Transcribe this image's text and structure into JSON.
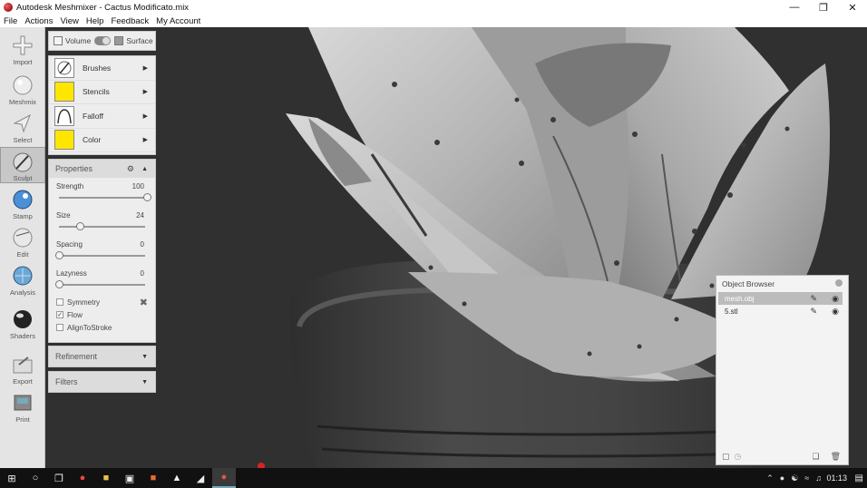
{
  "window": {
    "title": "Autodesk Meshmixer - Cactus Modificato.mix"
  },
  "menu": [
    "File",
    "Actions",
    "View",
    "Help",
    "Feedback",
    "My Account"
  ],
  "tools": [
    {
      "label": "Import",
      "icon": "plus-icon"
    },
    {
      "label": "Meshmix",
      "icon": "sphere-icon"
    },
    {
      "label": "Select",
      "icon": "arrow-cursor-icon"
    },
    {
      "label": "Sculpt",
      "icon": "brush-icon",
      "active": true
    },
    {
      "label": "Stamp",
      "icon": "stamp-icon"
    },
    {
      "label": "Edit",
      "icon": "edit-sphere-icon"
    },
    {
      "label": "Analysis",
      "icon": "analysis-icon"
    },
    {
      "label": "Shaders",
      "icon": "shader-ball-icon"
    },
    {
      "label": "Export",
      "icon": "export-folder-icon"
    },
    {
      "label": "Print",
      "icon": "printer-icon"
    }
  ],
  "sculpt": {
    "mode_volume": "Volume",
    "mode_surface": "Surface",
    "rows": [
      {
        "label": "Brushes",
        "color": "#ffffff",
        "icon": "brush-stroke-icon"
      },
      {
        "label": "Stencils",
        "color": "#ffe600",
        "icon": "stencil-swatch-icon"
      },
      {
        "label": "Falloff",
        "color": "#ffffff",
        "icon": "falloff-curve-icon"
      },
      {
        "label": "Color",
        "color": "#ffe600",
        "icon": "color-swatch-icon"
      }
    ]
  },
  "properties": {
    "title": "Properties",
    "sliders": [
      {
        "name": "Strength",
        "value": "100",
        "fraction": 1.0
      },
      {
        "name": "Size",
        "value": "24",
        "fraction": 0.24
      },
      {
        "name": "Spacing",
        "value": "0",
        "fraction": 0.0
      },
      {
        "name": "Lazyness",
        "value": "0",
        "fraction": 0.0
      }
    ],
    "checks": [
      {
        "label": "Symmetry",
        "checked": false
      },
      {
        "label": "Flow",
        "checked": true
      },
      {
        "label": "AlignToStroke",
        "checked": false
      }
    ]
  },
  "refinement": {
    "title": "Refinement"
  },
  "filters": {
    "title": "Filters"
  },
  "object_browser": {
    "title": "Object Browser",
    "objects": [
      {
        "name": "mesh.obj",
        "selected": true
      },
      {
        "name": "5.stl",
        "selected": false
      }
    ]
  },
  "taskbar": {
    "clock": "01:13"
  }
}
